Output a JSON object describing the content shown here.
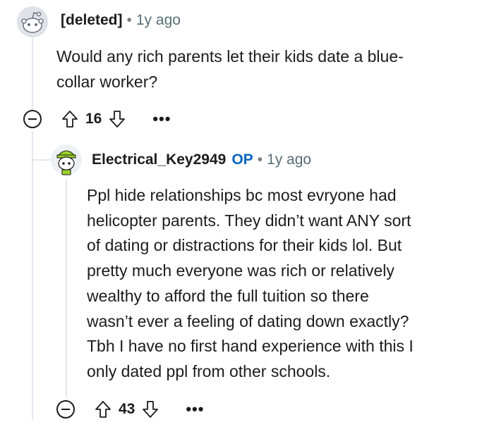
{
  "comments": [
    {
      "author": "[deleted]",
      "time": "1y ago",
      "text_lines": [
        "Would any rich parents let their kids date a blue-",
        "collar worker?"
      ],
      "score": "16",
      "avatar_icon": "snoo-deleted-avatar-icon"
    },
    {
      "author": "Electrical_Key2949",
      "badge": "OP",
      "time": "1y ago",
      "text_lines": [
        "Ppl hide relationships bc most evryone had",
        "helicopter parents. They didn’t want ANY sort",
        "of dating or distractions for their kids lol. But",
        "pretty much everyone was rich or relatively",
        "wealthy to afford the full tuition so there",
        "wasn’t ever a feeling of dating down exactly?",
        "Tbh I have no first hand experience with this I",
        "only dated ppl from other schools."
      ],
      "score": "43",
      "avatar_icon": "snoo-green-hat-avatar-icon"
    }
  ],
  "icons": {
    "collapse": "collapse-icon",
    "upvote": "upvote-arrow-icon",
    "downvote": "downvote-arrow-icon",
    "more": "more-options-icon"
  },
  "more_label": "•••",
  "separator": "•",
  "colors": {
    "op": "#0a66c2",
    "meta": "#576f76",
    "text": "#1c1c1c"
  }
}
